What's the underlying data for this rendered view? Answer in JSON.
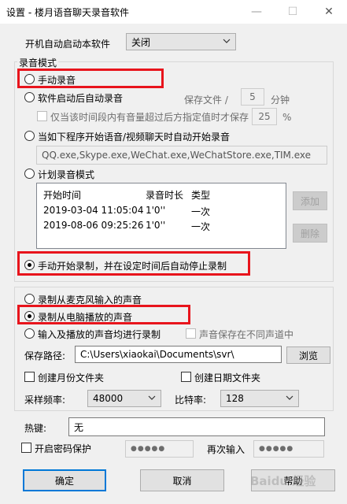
{
  "window": {
    "title": "设置 - 楼月语音聊天录音软件",
    "min_glyph": "—",
    "max_glyph": "☐",
    "close_glyph": "✕"
  },
  "autostart": {
    "label": "开机自动启动本软件",
    "value": "关闭"
  },
  "record_mode": {
    "group_label": "录音模式",
    "manual": "手动录音",
    "auto_start": "软件启动后自动录音",
    "save_file_label": "保存文件 /",
    "save_file_value": "5",
    "save_file_unit": "分钟",
    "volume_check": "仅当该时间段内有音量超过后方指定值时才保存",
    "volume_value": "25",
    "volume_unit": "%",
    "auto_program": "当如下程序开始语音/视频聊天时自动开始录音",
    "programs": "QQ.exe,Skype.exe,WeChat.exe,WeChatStore.exe,TIM.exe",
    "schedule": "计划录音模式",
    "columns": [
      "开始时间",
      "录音时长",
      "类型"
    ],
    "rows": [
      [
        "2019-03-04 11:05:04",
        "1'0''",
        "一次"
      ],
      [
        "2019-08-06 09:25:26",
        "1'0''",
        "一次"
      ]
    ],
    "add_button": "添加",
    "delete_button": "删除",
    "manual_timed": "手动开始录制，并在设定时间后自动停止录制"
  },
  "source": {
    "mic": "录制从麦克风输入的声音",
    "speaker": "录制从电脑播放的声音",
    "both": "输入及播放的声音均进行录制",
    "separate_channel": "声音保存在不同声道中",
    "save_path_label": "保存路径:",
    "save_path_value": "C:\\Users\\xiaokai\\Documents\\svr\\",
    "browse_button": "浏览",
    "month_folder": "创建月份文件夹",
    "date_folder": "创建日期文件夹",
    "sample_rate_label": "采样频率:",
    "sample_rate_value": "48000",
    "bitrate_label": "比特率:",
    "bitrate_value": "128"
  },
  "hotkey": {
    "label": "热键:",
    "value": "无"
  },
  "password": {
    "enable_label": "开启密码保护",
    "mask": "●●●●●",
    "repeat_label": "再次输入",
    "repeat_mask": "●●●●●"
  },
  "buttons": {
    "ok": "确定",
    "cancel": "取消",
    "help": "帮助"
  },
  "watermark": "Baidu 经验",
  "colors": {
    "accent": "#0078d7",
    "highlight_red": "#e8141c",
    "face": "#f0f0f0"
  }
}
